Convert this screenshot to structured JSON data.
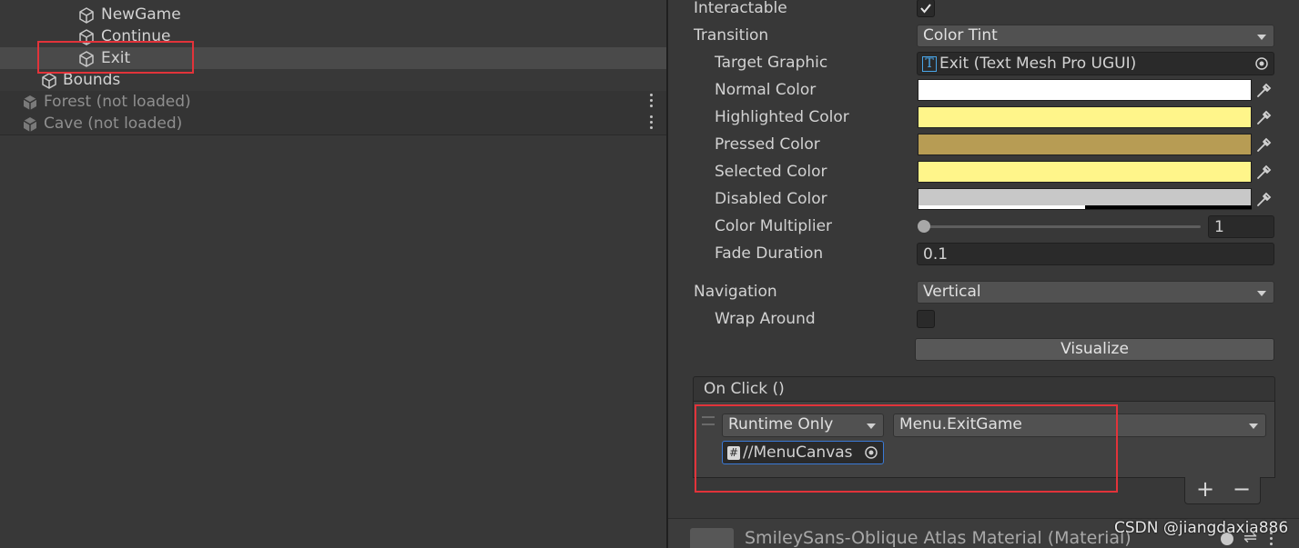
{
  "hierarchy": {
    "items": [
      {
        "label": "NewGame"
      },
      {
        "label": "Continue"
      },
      {
        "label": "Exit"
      },
      {
        "label": "Bounds"
      },
      {
        "label": "Forest (not loaded)"
      },
      {
        "label": "Cave (not loaded)"
      }
    ]
  },
  "inspector": {
    "interactable_label": "Interactable",
    "interactable_checked": true,
    "transition_label": "Transition",
    "transition_value": "Color Tint",
    "target_graphic_label": "Target Graphic",
    "target_graphic_value": "Exit (Text Mesh Pro UGUI)",
    "target_graphic_icon_letter": "T",
    "colors": [
      {
        "label": "Normal Color",
        "hex": "#ffffff"
      },
      {
        "label": "Highlighted Color",
        "hex": "#fff58a"
      },
      {
        "label": "Pressed Color",
        "hex": "#b79c54"
      },
      {
        "label": "Selected Color",
        "hex": "#fff58a"
      },
      {
        "label": "Disabled Color",
        "hex": "#c8c8c8"
      }
    ],
    "color_multiplier_label": "Color Multiplier",
    "color_multiplier_value": "1",
    "fade_duration_label": "Fade Duration",
    "fade_duration_value": "0.1",
    "navigation_label": "Navigation",
    "navigation_value": "Vertical",
    "wrap_around_label": "Wrap Around",
    "visualize_label": "Visualize",
    "onclick_header": "On Click ()",
    "runtime_value": "Runtime Only",
    "function_value": "Menu.ExitGame",
    "object_value": "//MenuCanvas",
    "object_icon_letter": "#",
    "add_label": "+",
    "remove_label": "−",
    "material_label": "SmileySans-Oblique Atlas Material (Material)"
  },
  "watermark": "CSDN @jiangdaxia886",
  "icons": [
    "gameobject-cube-icon",
    "scene-icon",
    "kebab-menu-icon",
    "eyedropper-icon",
    "object-picker-icon",
    "checkmark-icon",
    "dropdown-caret-icon",
    "textmeshpro-icon",
    "script-icon",
    "drag-handle-icon"
  ],
  "colors": {
    "highlight_box": "#e2333a",
    "selection": "#4a4a4a",
    "focus_blue": "#3a79d6"
  }
}
